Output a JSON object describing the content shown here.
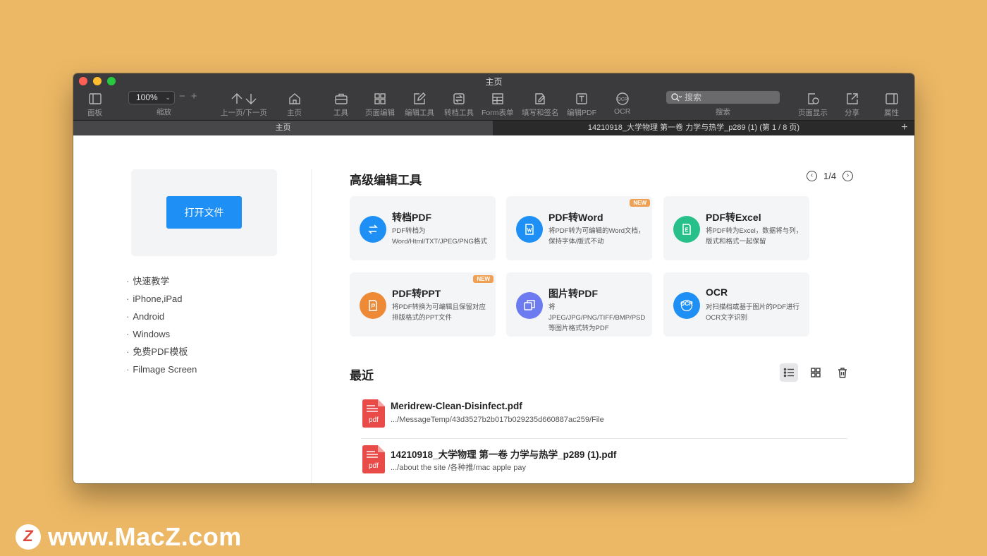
{
  "window": {
    "title": "主页"
  },
  "toolbar": {
    "panel": "面板",
    "zoom_value": "100%",
    "zoom_label": "缩放",
    "prev_next": "上一页/下一页",
    "home": "主页",
    "tools": "工具",
    "page_edit": "页面编辑",
    "edit_tools": "编辑工具",
    "convert_tools": "转档工具",
    "form": "Form表单",
    "fill_sign": "填写和签名",
    "edit_pdf": "编辑PDF",
    "ocr": "OCR",
    "search_placeholder": "搜索",
    "search_label": "搜索",
    "page_display": "页面显示",
    "share": "分享",
    "properties": "属性"
  },
  "tabs": {
    "home": "主页",
    "doc": "14210918_大学物理  第一卷  力学与热学_p289 (1) (第 1 / 8 页)",
    "plus": "+"
  },
  "sidebar": {
    "open_file": "打开文件",
    "links": [
      "快速教学",
      "iPhone,iPad",
      "Android",
      "Windows",
      "免费PDF模板",
      "Filmage Screen"
    ]
  },
  "tools_section": {
    "title": "高级编辑工具",
    "pager": "1/4",
    "cards": [
      {
        "name": "转档PDF",
        "desc": "PDF转档为Word/Html/TXT/JPEG/PNG格式",
        "color": "#1d8ff5",
        "icon": "convert-icon"
      },
      {
        "name": "PDF转Word",
        "desc": "将PDF转为可编辑的Word文档，保持字体/版式不动",
        "color": "#1d8ff5",
        "icon": "word-icon",
        "badge": "NEW"
      },
      {
        "name": "PDF转Excel",
        "desc": "将PDF转为Excel，数据将与列，版式和格式一起保留",
        "color": "#28c08a",
        "icon": "excel-icon"
      },
      {
        "name": "PDF转PPT",
        "desc": "将PDF转换为可编辑且保留对应排版格式的PPT文件",
        "color": "#ee8a35",
        "icon": "ppt-icon",
        "badge": "NEW"
      },
      {
        "name": "图片转PDF",
        "desc": "将JPEG/JPG/PNG/TIFF/BMP/PSD等图片格式转为PDF",
        "color": "#6c7cf0",
        "icon": "image-icon"
      },
      {
        "name": "OCR",
        "desc": "对扫描档或基于图片的PDF进行OCR文字识别",
        "color": "#1d8ff5",
        "icon": "ocr-icon",
        "icon_text": "OCR"
      }
    ]
  },
  "recent": {
    "title": "最近",
    "items": [
      {
        "name": "Meridrew-Clean-Disinfect.pdf",
        "path": ".../MessageTemp/43d3527b2b017b029235d660887ac259/File"
      },
      {
        "name": "14210918_大学物理  第一卷  力学与热学_p289 (1).pdf",
        "path": ".../about the site /各种推/mac apple pay"
      }
    ],
    "file_icon_text": "pdf"
  },
  "watermark": {
    "logo": "Z",
    "text": "www.MacZ.com"
  }
}
